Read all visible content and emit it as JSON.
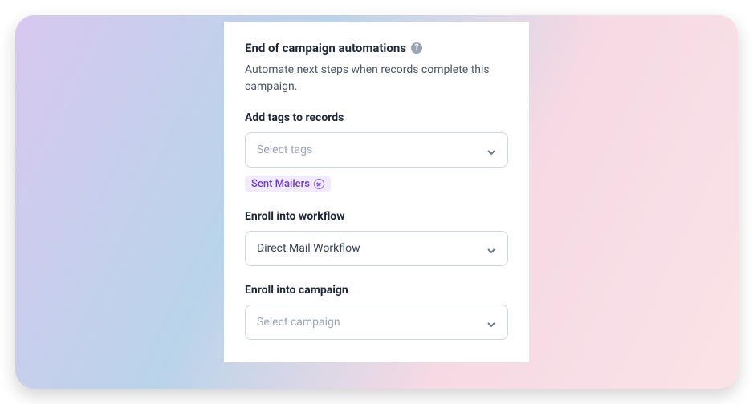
{
  "header": {
    "title": "End of campaign automations",
    "description": "Automate next steps when records complete this campaign."
  },
  "fields": {
    "tags": {
      "label": "Add tags to records",
      "placeholder": "Select tags",
      "selected": [
        {
          "name": "Sent Mailers"
        }
      ]
    },
    "workflow": {
      "label": "Enroll into workflow",
      "value": "Direct Mail Workflow"
    },
    "campaign": {
      "label": "Enroll into campaign",
      "placeholder": "Select campaign"
    }
  }
}
